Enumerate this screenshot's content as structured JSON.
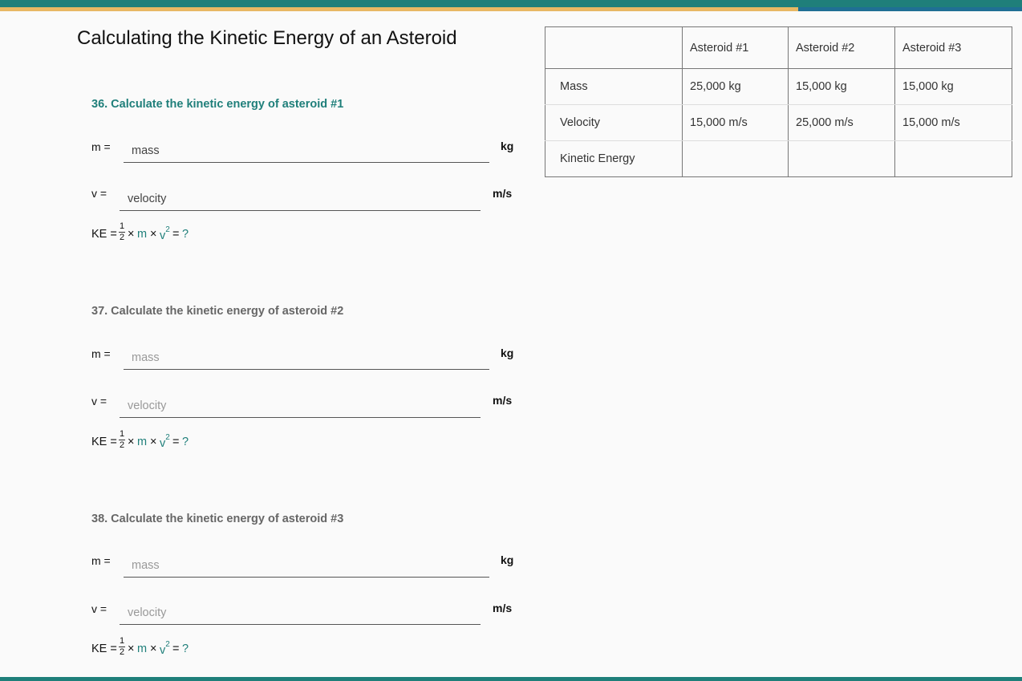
{
  "title": "Calculating the Kinetic Energy of an Asteroid",
  "labels": {
    "m": "m =",
    "v": "v =",
    "ke": "KE ="
  },
  "units": {
    "mass": "kg",
    "velocity": "m/s"
  },
  "placeholders": {
    "mass": "mass",
    "velocity": "velocity"
  },
  "formula": {
    "frac_num": "1",
    "frac_den": "2",
    "times1": "×",
    "m": "m",
    "times2": "×",
    "v": "v",
    "exp": "2",
    "equals": "=",
    "q": "?"
  },
  "questions": [
    {
      "label": "36. Calculate the kinetic energy of asteroid #1"
    },
    {
      "label": "37. Calculate the kinetic energy of asteroid #2"
    },
    {
      "label": "38. Calculate the kinetic energy of asteroid #3"
    }
  ],
  "table": {
    "headers": [
      "",
      "Asteroid #1",
      "Asteroid #2",
      "Asteroid #3"
    ],
    "rows": [
      {
        "label": "Mass",
        "cells": [
          "25,000 kg",
          "15,000 kg",
          "15,000 kg"
        ]
      },
      {
        "label": "Velocity",
        "cells": [
          "15,000 m/s",
          "25,000 m/s",
          "15,000 m/s"
        ]
      },
      {
        "label": "Kinetic Energy",
        "cells": [
          "",
          "",
          ""
        ]
      }
    ]
  },
  "colors": {
    "accent": "#1f7f7a",
    "gold": "#e8b864",
    "blue": "#1f6f94"
  }
}
